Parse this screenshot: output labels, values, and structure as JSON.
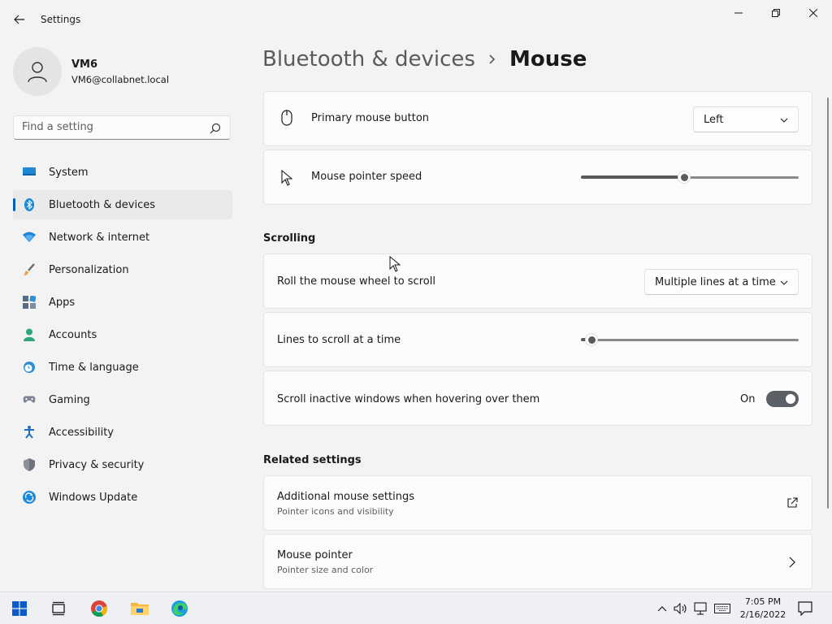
{
  "window": {
    "title": "Settings"
  },
  "profile": {
    "name": "VM6",
    "email": "VM6@collabnet.local"
  },
  "search": {
    "placeholder": "Find a setting"
  },
  "nav": {
    "items": [
      {
        "label": "System",
        "icon": "monitor-icon"
      },
      {
        "label": "Bluetooth & devices",
        "icon": "bluetooth-icon",
        "active": true
      },
      {
        "label": "Network & internet",
        "icon": "wifi-icon"
      },
      {
        "label": "Personalization",
        "icon": "brush-icon"
      },
      {
        "label": "Apps",
        "icon": "apps-icon"
      },
      {
        "label": "Accounts",
        "icon": "person-icon"
      },
      {
        "label": "Time & language",
        "icon": "clock-globe-icon"
      },
      {
        "label": "Gaming",
        "icon": "gamepad-icon"
      },
      {
        "label": "Accessibility",
        "icon": "accessibility-icon"
      },
      {
        "label": "Privacy & security",
        "icon": "shield-icon"
      },
      {
        "label": "Windows Update",
        "icon": "update-icon"
      }
    ]
  },
  "breadcrumb": {
    "parent": "Bluetooth & devices",
    "current": "Mouse"
  },
  "mouse": {
    "primary_button": {
      "label": "Primary mouse button",
      "value": "Left"
    },
    "pointer_speed": {
      "label": "Mouse pointer speed",
      "value_fraction": 0.475
    }
  },
  "scrolling": {
    "title": "Scrolling",
    "roll_wheel": {
      "label": "Roll the mouse wheel to scroll",
      "value": "Multiple lines at a time"
    },
    "lines": {
      "label": "Lines to scroll at a time",
      "value_fraction": 0.05
    },
    "inactive": {
      "label": "Scroll inactive windows when hovering over them",
      "state": "On"
    }
  },
  "related": {
    "title": "Related settings",
    "additional": {
      "label": "Additional mouse settings",
      "sub": "Pointer icons and visibility"
    },
    "pointer": {
      "label": "Mouse pointer",
      "sub": "Pointer size and color"
    }
  },
  "taskbar": {
    "time": "7:05 PM",
    "date": "2/16/2022"
  },
  "colors": {
    "accent": "#005fb8",
    "toggle_on": "#5b5f66"
  }
}
